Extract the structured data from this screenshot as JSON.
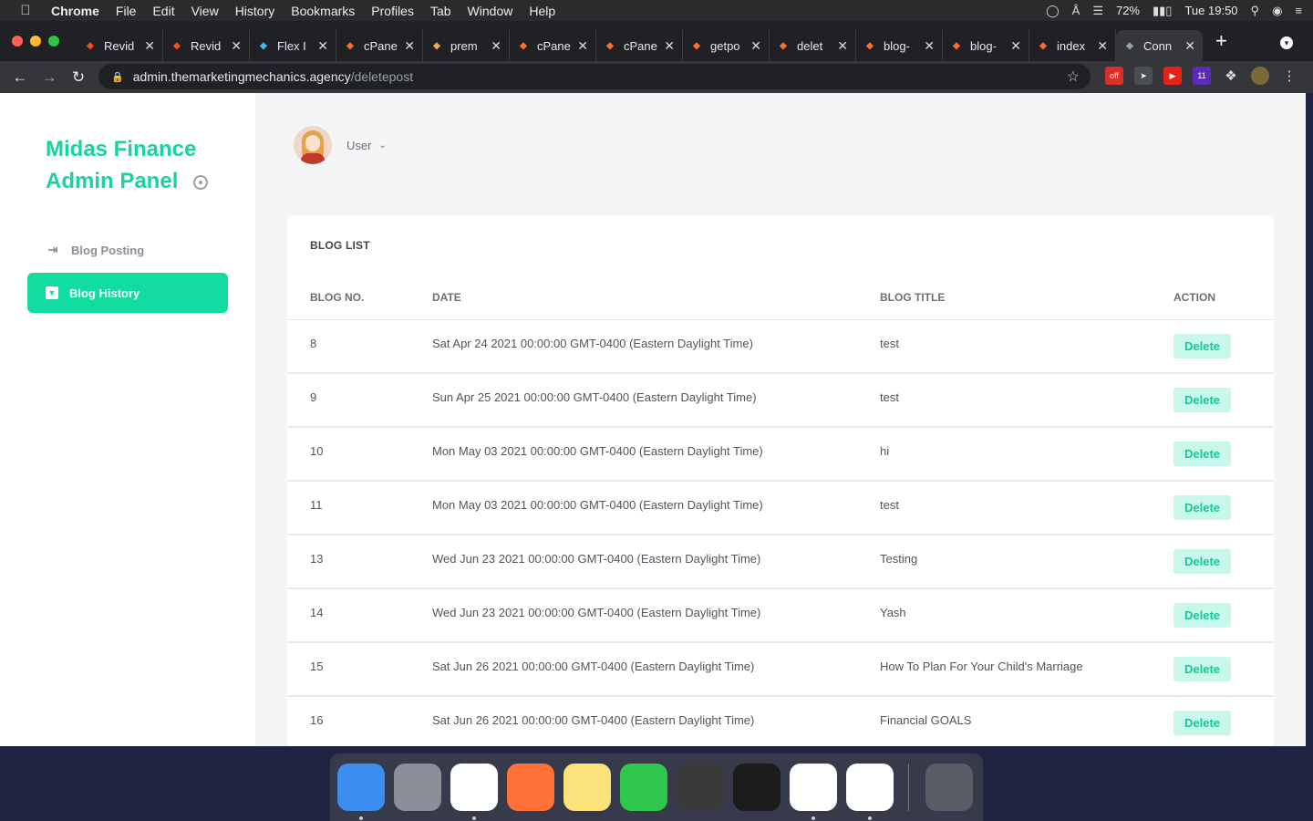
{
  "menubar": {
    "app": "Chrome",
    "items": [
      "File",
      "Edit",
      "View",
      "History",
      "Bookmarks",
      "Profiles",
      "Tab",
      "Window",
      "Help"
    ],
    "battery": "72%",
    "clock": "Tue 19:50"
  },
  "tabs": [
    {
      "label": "Revid",
      "icon": "figma-icon",
      "color": "#f24e1e"
    },
    {
      "label": "Revid",
      "icon": "figma-icon",
      "color": "#f24e1e"
    },
    {
      "label": "Flex I",
      "icon": "tailwind-icon",
      "color": "#38bdf8"
    },
    {
      "label": "cPane",
      "icon": "cpanel-icon",
      "color": "#ff6c2c"
    },
    {
      "label": "prem",
      "icon": "premium-icon",
      "color": "#f4a742"
    },
    {
      "label": "cPane",
      "icon": "cpanel-icon",
      "color": "#ff6c2c"
    },
    {
      "label": "cPane",
      "icon": "cpanel-icon",
      "color": "#ff6c2c"
    },
    {
      "label": "getpo",
      "icon": "cpanel-icon",
      "color": "#ff6c2c"
    },
    {
      "label": "delet",
      "icon": "cpanel-icon",
      "color": "#ff6c2c"
    },
    {
      "label": "blog-",
      "icon": "cpanel-icon",
      "color": "#ff6c2c"
    },
    {
      "label": "blog-",
      "icon": "cpanel-icon",
      "color": "#ff6c2c"
    },
    {
      "label": "index",
      "icon": "cpanel-icon",
      "color": "#ff6c2c"
    },
    {
      "label": "Conn",
      "icon": "globe-icon",
      "color": "#9aa0a6"
    }
  ],
  "url": {
    "host": "admin.themarketingmechanics.agency",
    "path": "/deletepost"
  },
  "brand": {
    "line1": "Midas Finance",
    "line2": "Admin Panel",
    "color": "#19d3a2"
  },
  "nav": {
    "posting": "Blog Posting",
    "history": "Blog History"
  },
  "user": {
    "name": "User"
  },
  "card": {
    "title": "BLOG LIST",
    "columns": [
      "BLOG NO.",
      "DATE",
      "BLOG TITLE",
      "ACTION"
    ],
    "rows": [
      {
        "no": "8",
        "date": "Sat Apr 24 2021 00:00:00 GMT-0400 (Eastern Daylight Time)",
        "title": "test",
        "action": "Delete"
      },
      {
        "no": "9",
        "date": "Sun Apr 25 2021 00:00:00 GMT-0400 (Eastern Daylight Time)",
        "title": "test",
        "action": "Delete"
      },
      {
        "no": "10",
        "date": "Mon May 03 2021 00:00:00 GMT-0400 (Eastern Daylight Time)",
        "title": "hi",
        "action": "Delete"
      },
      {
        "no": "11",
        "date": "Mon May 03 2021 00:00:00 GMT-0400 (Eastern Daylight Time)",
        "title": "test",
        "action": "Delete"
      },
      {
        "no": "13",
        "date": "Wed Jun 23 2021 00:00:00 GMT-0400 (Eastern Daylight Time)",
        "title": "Testing",
        "action": "Delete"
      },
      {
        "no": "14",
        "date": "Wed Jun 23 2021 00:00:00 GMT-0400 (Eastern Daylight Time)",
        "title": "Yash",
        "action": "Delete"
      },
      {
        "no": "15",
        "date": "Sat Jun 26 2021 00:00:00 GMT-0400 (Eastern Daylight Time)",
        "title": "How To Plan For Your Child's Marriage",
        "action": "Delete"
      },
      {
        "no": "16",
        "date": "Sat Jun 26 2021 00:00:00 GMT-0400 (Eastern Daylight Time)",
        "title": "Financial GOALS",
        "action": "Delete"
      }
    ]
  },
  "dock": [
    {
      "name": "finder-icon",
      "color": "#3c8df0",
      "running": true
    },
    {
      "name": "launchpad-icon",
      "color": "#8c8f99",
      "running": false
    },
    {
      "name": "chrome-icon",
      "color": "#ffffff",
      "running": true
    },
    {
      "name": "firefox-icon",
      "color": "#ff7139",
      "running": false
    },
    {
      "name": "notes-icon",
      "color": "#fbe27a",
      "running": false
    },
    {
      "name": "facetime-icon",
      "color": "#2fc84d",
      "running": false
    },
    {
      "name": "sublime-text-icon",
      "color": "#3a3a3a",
      "running": false
    },
    {
      "name": "terminal-icon",
      "color": "#1c1c1c",
      "running": false
    },
    {
      "name": "vscode-icon",
      "color": "#ffffff",
      "running": true
    },
    {
      "name": "slack-icon",
      "color": "#ffffff",
      "running": true
    },
    {
      "name": "trash-icon",
      "color": "#5a5c66",
      "running": false
    }
  ]
}
